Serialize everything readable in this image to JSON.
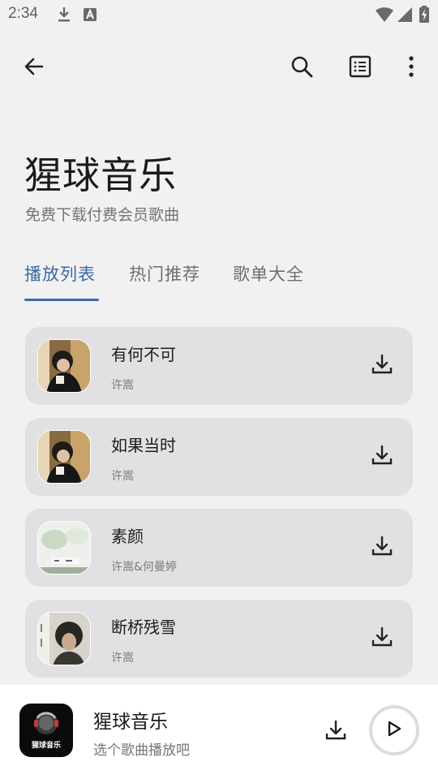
{
  "status_bar": {
    "time": "2:34"
  },
  "icons": {
    "back": "arrow-left-icon",
    "search": "search-icon",
    "list": "list-icon",
    "more": "more-vertical-icon",
    "download": "download-icon",
    "play": "play-icon"
  },
  "header": {
    "title": "猩球音乐",
    "subtitle": "免费下载付费会员歌曲"
  },
  "tabs": [
    {
      "label": "播放列表",
      "active": true
    },
    {
      "label": "热门推荐",
      "active": false
    },
    {
      "label": "歌单大全",
      "active": false
    }
  ],
  "songs": [
    {
      "title": "有何不可",
      "artist": "许嵩"
    },
    {
      "title": "如果当时",
      "artist": "许嵩"
    },
    {
      "title": "素颜",
      "artist": "许嵩&何曼婷"
    },
    {
      "title": "断桥残雪",
      "artist": "许嵩"
    }
  ],
  "player": {
    "title": "猩球音乐",
    "subtitle": "选个歌曲播放吧",
    "cover_text": "猩球音乐"
  },
  "colors": {
    "accent": "#3d6aa6",
    "background": "#f1f1f1",
    "card": "#e1e1e3"
  }
}
